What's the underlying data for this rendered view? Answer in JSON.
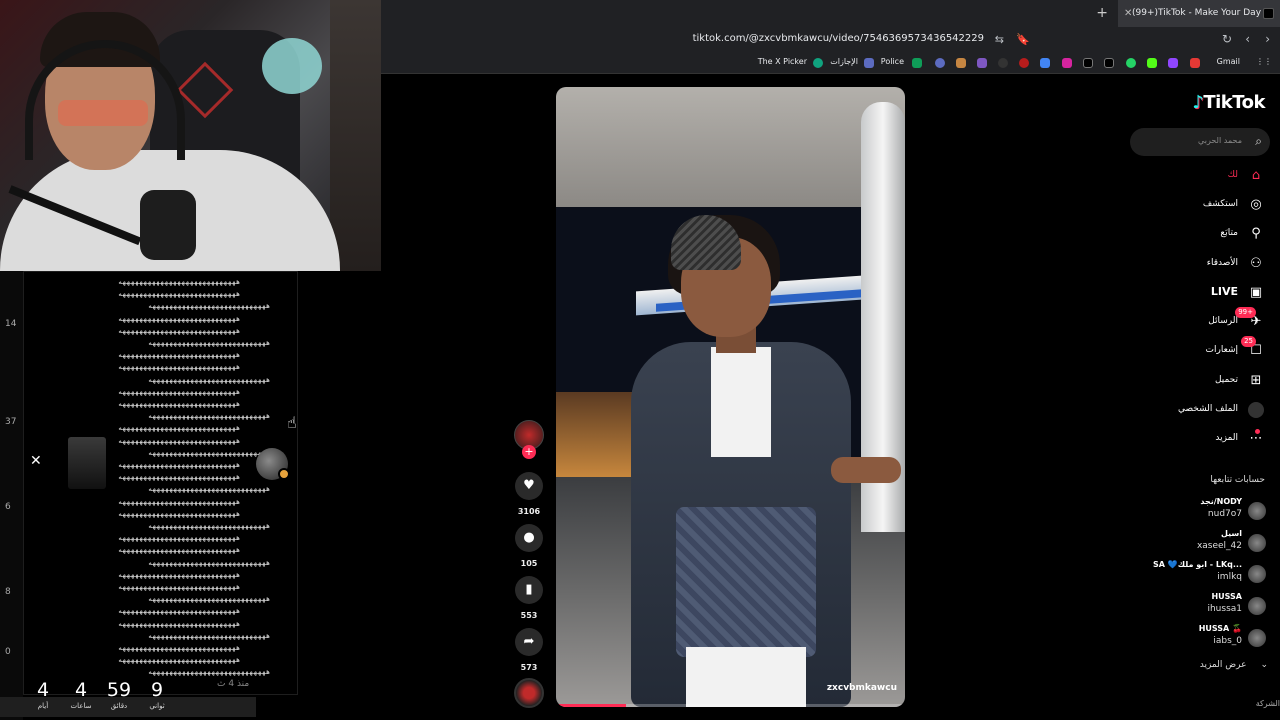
{
  "browser": {
    "tab_title": "(99+)TikTok - Make Your Day",
    "url": "tiktok.com/@zxcvbmkawcu/video/7546369573436542229",
    "bookmarks": [
      "Gmail",
      "Police",
      "الإجازات",
      "The X Picker"
    ]
  },
  "left_panel": {
    "side_numbers": [
      "14",
      "37",
      "6",
      "8",
      "0"
    ],
    "comment_text": "ههههههههههههههههههههههههههههه",
    "comment_time": "منذ 4 ث",
    "countdown": [
      {
        "value": "4",
        "label": "أيام"
      },
      {
        "value": "4",
        "label": "ساعات"
      },
      {
        "value": "59",
        "label": "دقائق"
      },
      {
        "value": "9",
        "label": "ثواني"
      }
    ]
  },
  "video": {
    "handle": "zxcvbmkawcu",
    "progress": 0.2
  },
  "actions": {
    "likes": "3106",
    "comments": "105",
    "saves": "553",
    "shares": "573"
  },
  "sidebar": {
    "logo": "TikTok",
    "search_placeholder": "محمد الحربي",
    "nav": [
      {
        "label": "لك",
        "icon": "home-icon",
        "active": true
      },
      {
        "label": "استكشف",
        "icon": "compass-icon"
      },
      {
        "label": "متابَع",
        "icon": "user-follow-icon"
      },
      {
        "label": "الأصدقاء",
        "icon": "friends-icon"
      },
      {
        "label": "LIVE",
        "icon": "live-icon",
        "bold": true
      },
      {
        "label": "الرسائل",
        "icon": "messages-icon",
        "badge": "99+"
      },
      {
        "label": "إشعارات",
        "icon": "inbox-icon",
        "badge": "25"
      },
      {
        "label": "تحميل",
        "icon": "upload-icon"
      },
      {
        "label": "الملف الشخصي",
        "icon": "profile-avatar"
      },
      {
        "label": "المزيد",
        "icon": "more-icon",
        "dot": true
      }
    ],
    "following_title": "حسابات تتابعها",
    "following": [
      {
        "name": "نجد/NODY",
        "handle": "nud7o7"
      },
      {
        "name": "اسيل",
        "handle": "xaseel_42"
      },
      {
        "name": "SA 💙ابو ملك - LKq...",
        "handle": "imlkq"
      },
      {
        "name": "HUSSA",
        "handle": "ihussa1"
      },
      {
        "name": "HUSSA 🍒",
        "handle": "iabs_0"
      }
    ],
    "see_more": "عرض المزيد",
    "footer": "الشركة"
  }
}
